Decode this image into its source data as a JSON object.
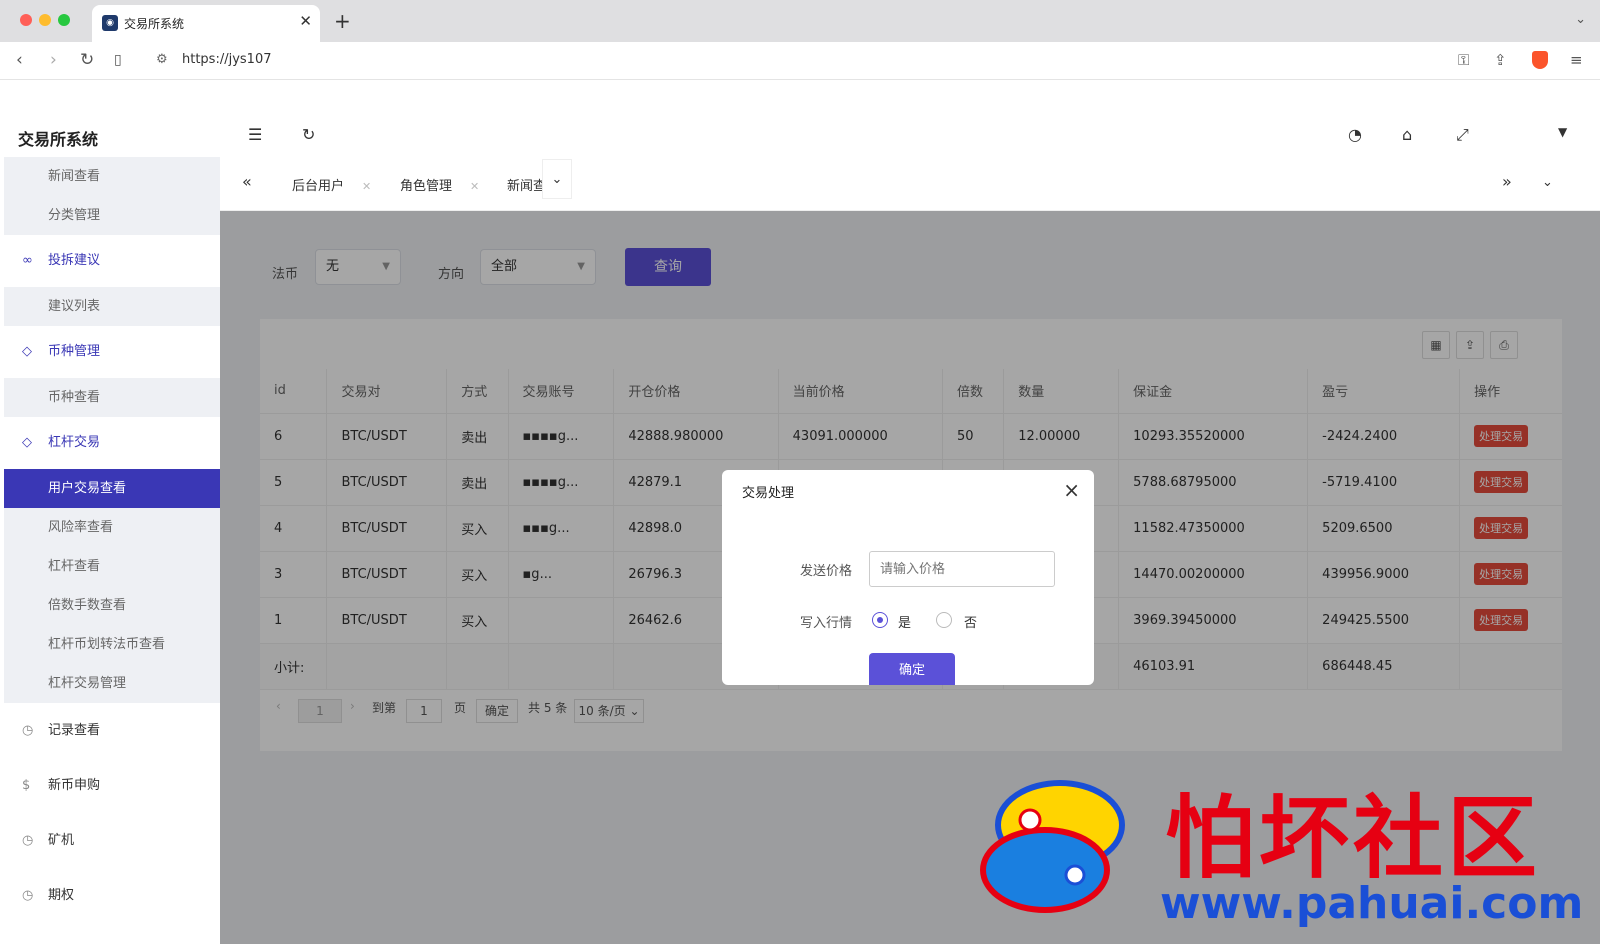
{
  "browser": {
    "tab_title": "交易所系统",
    "url": "https://jys107"
  },
  "app": {
    "brand": "交易所系统",
    "menu": [
      {
        "type": "sub",
        "label": "新闻查看"
      },
      {
        "type": "sub",
        "label": "分类管理"
      },
      {
        "type": "grp",
        "label": "投拆建议",
        "icon": "link-icon"
      },
      {
        "type": "sub",
        "label": "建议列表"
      },
      {
        "type": "grp",
        "label": "币种管理",
        "icon": "diamond-icon"
      },
      {
        "type": "sub",
        "label": "币种查看"
      },
      {
        "type": "grp",
        "label": "杠杆交易",
        "icon": "diamond-icon"
      },
      {
        "type": "sub",
        "label": "用户交易查看",
        "active": true
      },
      {
        "type": "sub",
        "label": "风险率查看"
      },
      {
        "type": "sub",
        "label": "杠杆查看"
      },
      {
        "type": "sub",
        "label": "倍数手数查看"
      },
      {
        "type": "sub",
        "label": "杠杆币划转法币查看"
      },
      {
        "type": "sub",
        "label": "杠杆交易管理"
      },
      {
        "type": "plain",
        "label": "记录查看",
        "icon": "clock-icon"
      },
      {
        "type": "plain",
        "label": "新币申购",
        "icon": "dollar-icon"
      },
      {
        "type": "plain",
        "label": "矿机",
        "icon": "clock-icon"
      },
      {
        "type": "plain",
        "label": "期权",
        "icon": "clock-icon"
      }
    ],
    "page_tabs": [
      "后台用户",
      "角色管理",
      "新闻查"
    ],
    "filters": {
      "fiat_label": "法币",
      "fiat_value": "无",
      "direction_label": "方向",
      "direction_value": "全部",
      "query_button": "查询"
    },
    "table": {
      "headers": [
        "id",
        "交易对",
        "方式",
        "交易账号",
        "开仓价格",
        "当前价格",
        "倍数",
        "数量",
        "保证金",
        "盈亏",
        "操作"
      ],
      "rows": [
        [
          "6",
          "BTC/USDT",
          "卖出",
          "▪▪▪▪g...",
          "42888.980000",
          "43091.000000",
          "50",
          "12.00000",
          "10293.35520000",
          "-2424.2400",
          "处理交易"
        ],
        [
          "5",
          "BTC/USDT",
          "卖出",
          "▪▪▪▪g...",
          "42879.1",
          "",
          "",
          "",
          "5788.68795000",
          "-5719.4100",
          "处理交易"
        ],
        [
          "4",
          "BTC/USDT",
          "买入",
          "▪▪▪g...",
          "42898.0",
          "",
          "",
          "",
          "11582.47350000",
          "5209.6500",
          "处理交易"
        ],
        [
          "3",
          "BTC/USDT",
          "买入",
          "▪g...",
          "26796.3",
          "",
          "",
          "",
          "14470.00200000",
          "439956.9000",
          "处理交易"
        ],
        [
          "1",
          "BTC/USDT",
          "买入",
          "",
          "26462.6",
          "",
          "",
          "",
          "3969.39450000",
          "249425.5500",
          "处理交易"
        ]
      ],
      "subtotal_label": "小计:",
      "subtotal_margin": "46103.91",
      "subtotal_pnl": "686448.45"
    },
    "pager": {
      "current": "1",
      "goto_label": "到第",
      "goto_value": "1",
      "page_unit": "页",
      "confirm": "确定",
      "total": "共 5 条",
      "size": "10 条/页"
    },
    "modal": {
      "title": "交易处理",
      "price_label": "发送价格",
      "price_placeholder": "请输入价格",
      "market_label": "写入行情",
      "yes": "是",
      "no": "否",
      "ok": "确定"
    }
  },
  "watermark": {
    "text": "怕坏社区",
    "url": "www.pahuai.com"
  },
  "colors": {
    "primary": "#5b51d8",
    "menu_active": "#3a37b5",
    "danger": "#e74c3c"
  }
}
